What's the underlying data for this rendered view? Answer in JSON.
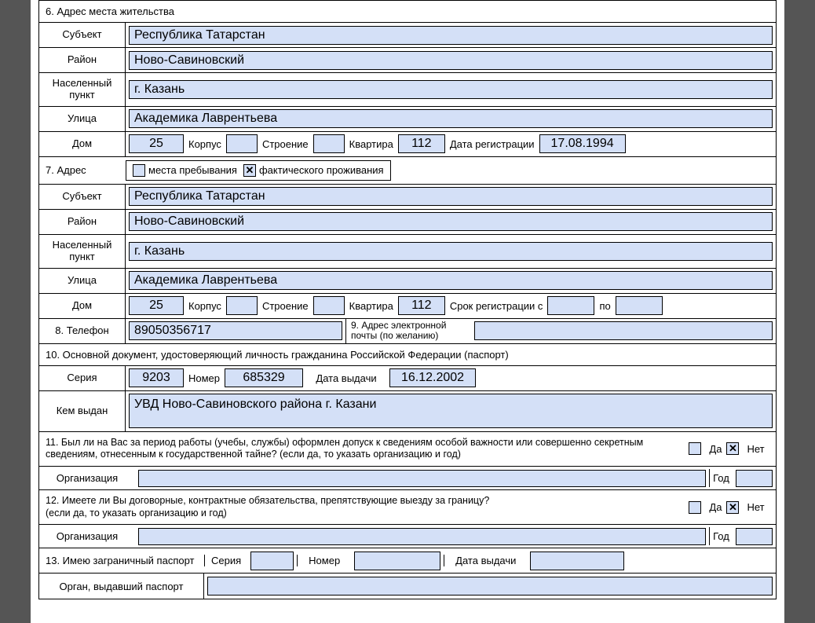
{
  "section6": {
    "title": "6. Адрес места жительства",
    "subject_label": "Субъект",
    "subject": "Республика Татарстан",
    "district_label": "Район",
    "district": "Ново-Савиновский",
    "city_label": "Населенный пункт",
    "city": "г. Казань",
    "street_label": "Улица",
    "street": "Академика Лаврентьева",
    "house_label": "Дом",
    "house": "25",
    "korpus_label": "Корпус",
    "korpus": "",
    "building_label": "Строение",
    "building": "",
    "flat_label": "Квартира",
    "flat": "112",
    "reg_date_label": "Дата регистрации",
    "reg_date": "17.08.1994"
  },
  "section7": {
    "title": "7. Адрес",
    "opt_stay": "места пребывания",
    "opt_stay_checked": "",
    "opt_actual": "фактического проживания",
    "opt_actual_checked": "✕",
    "subject_label": "Субъект",
    "subject": "Республика Татарстан",
    "district_label": "Район",
    "district": "Ново-Савиновский",
    "city_label": "Населенный пункт",
    "city": "г. Казань",
    "street_label": "Улица",
    "street": "Академика Лаврентьева",
    "house_label": "Дом",
    "house": "25",
    "korpus_label": "Корпус",
    "korpus": "",
    "building_label": "Строение",
    "building": "",
    "flat_label": "Квартира",
    "flat": "112",
    "reg_period_label": "Срок регистрации с",
    "reg_from": "",
    "reg_to_label": "по",
    "reg_to": ""
  },
  "section8": {
    "label": "8. Телефон",
    "value": "89050356717"
  },
  "section9": {
    "label": "9. Адрес электронной почты (по желанию)",
    "value": ""
  },
  "section10": {
    "title": "10. Основной документ, удостоверяющий личность гражданина Российской Федерации (паспорт)",
    "series_label": "Серия",
    "series": "9203",
    "number_label": "Номер",
    "number": "685329",
    "issue_date_label": "Дата выдачи",
    "issue_date": "16.12.2002",
    "issued_by_label": "Кем выдан",
    "issued_by": "УВД Ново-Савиновского района г. Казани"
  },
  "section11": {
    "question": "11. Был ли на Вас за период работы (учебы, службы) оформлен допуск к сведениям особой важности или совершенно секретным сведениям, отнесенным к государственной тайне? (если да, то указать организацию и год)",
    "yes_label": "Да",
    "yes_checked": "",
    "no_label": "Нет",
    "no_checked": "✕",
    "org_label": "Организация",
    "org": "",
    "year_label": "Год",
    "year": ""
  },
  "section12": {
    "question": "12. Имеете ли Вы договорные, контрактные обязательства, препятствующие выезду за границу?\n(если да, то указать организацию и год)",
    "yes_label": "Да",
    "yes_checked": "",
    "no_label": "Нет",
    "no_checked": "✕",
    "org_label": "Организация",
    "org": "",
    "year_label": "Год",
    "year": ""
  },
  "section13": {
    "title": "13. Имею заграничный паспорт",
    "series_label": "Серия",
    "series": "",
    "number_label": "Номер",
    "number": "",
    "issue_date_label": "Дата выдачи",
    "issue_date": "",
    "issued_by_label": "Орган, выдавший паспорт",
    "issued_by": ""
  }
}
